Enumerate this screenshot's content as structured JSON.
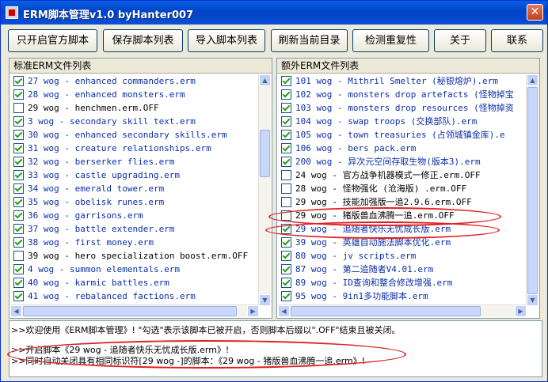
{
  "window": {
    "title": "ERM脚本管理v1.0  byHanter007",
    "close_glyph": "✕"
  },
  "toolbar": {
    "buttons": [
      "只开启官方脚本",
      "保存脚本列表",
      "导入脚本列表",
      "刷新当前目录",
      "检测重复性",
      "关于",
      "联系"
    ]
  },
  "left_panel": {
    "header": "标准ERM文件列表",
    "items": [
      {
        "text": "27 wog - enhanced commanders.erm",
        "checked": true
      },
      {
        "text": "28 wog - enhanced monsters.erm",
        "checked": true
      },
      {
        "text": "29 wog - henchmen.erm.OFF",
        "checked": false
      },
      {
        "text": "3 wog - secondary skill text.erm",
        "checked": true
      },
      {
        "text": "30 wog - enhanced secondary skills.erm",
        "checked": true
      },
      {
        "text": "31 wog - creature relationships.erm",
        "checked": true
      },
      {
        "text": "32 wog - berserker flies.erm",
        "checked": true
      },
      {
        "text": "33 wog - castle upgrading.erm",
        "checked": true
      },
      {
        "text": "34 wog - emerald tower.erm",
        "checked": true
      },
      {
        "text": "35 wog - obelisk runes.erm",
        "checked": true
      },
      {
        "text": "36 wog - garrisons.erm",
        "checked": true
      },
      {
        "text": "37 wog - battle extender.erm",
        "checked": true
      },
      {
        "text": "38 wog - first money.erm",
        "checked": true
      },
      {
        "text": "39 wog - hero specialization boost.erm.OFF",
        "checked": false
      },
      {
        "text": "4 wog - summon elementals.erm",
        "checked": true
      },
      {
        "text": "40 wog - karmic battles.erm",
        "checked": true
      },
      {
        "text": "41 wog - rebalanced factions.erm",
        "checked": true
      }
    ]
  },
  "right_panel": {
    "header": "额外ERM文件列表",
    "items": [
      {
        "text": "101 wog - Mithril Smelter (秘银熔炉).erm",
        "checked": true
      },
      {
        "text": "102 wog - monsters drop artefacts (怪物掉宝",
        "checked": true
      },
      {
        "text": "103 wog - monsters drop resources (怪物掉资",
        "checked": true
      },
      {
        "text": "104 wog - swap troops (交换部队).erm",
        "checked": true
      },
      {
        "text": "105 wog - town treasuries (占领城镇金库).e",
        "checked": true
      },
      {
        "text": "106 wog - bers pack.erm",
        "checked": true
      },
      {
        "text": "200 wog - 异次元空间存取生物(版本3).erm",
        "checked": true
      },
      {
        "text": "24 wog - 官方战争机器模式一修正.erm.OFF",
        "checked": false
      },
      {
        "text": "28 wog - 怪物强化 (沧海版) .erm.OFF",
        "checked": false
      },
      {
        "text": "29 wog - 技能加强版一追2.9.6.erm.OFF",
        "checked": false
      },
      {
        "text": "29 wog - 猪版兽血沸腾一追.erm.OFF",
        "checked": false
      },
      {
        "text": "29 wog - 追随者快乐无忧成长版.erm",
        "checked": true
      },
      {
        "text": "39 wog - 英雄自动施法脚本优化.erm",
        "checked": true
      },
      {
        "text": "80 wog - jv scripts.erm",
        "checked": true
      },
      {
        "text": "87 wog - 第二追随者V4.01.erm",
        "checked": true
      },
      {
        "text": "89 wog - ID查询和整合修改增强.erm",
        "checked": true
      },
      {
        "text": "95 wog - 9in1多功能脚本.erm",
        "checked": true
      }
    ]
  },
  "log": {
    "lines": [
      ">>欢迎使用《ERM脚本管理》! \"勾选\"表示该脚本已被开启，否则脚本后缀以\".OFF\"结束且被关闭。",
      ">>开启脚本《29 wog - 追随者快乐无忧成长版.erm》!",
      ">>同时自动关闭具有相同标识符[29 wog -]的脚本：《29 wog - 猪版兽血沸腾一追.erm》!"
    ]
  },
  "colors": {
    "titlebar": "#0054e3",
    "enabled_text": "#0b2ea8",
    "highlight": "#e02020"
  }
}
